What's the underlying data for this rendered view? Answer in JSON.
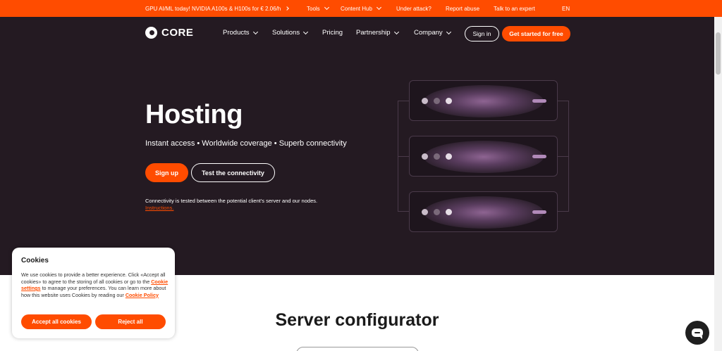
{
  "topbar": {
    "promo": "GPU AI/ML today! NVIDIA A100s & H100s for € 2.06/h",
    "tools": "Tools",
    "content_hub": "Content Hub",
    "under_attack": "Under attack?",
    "report_abuse": "Report abuse",
    "talk_expert": "Talk to an expert",
    "lang": "EN"
  },
  "header": {
    "logo": "CORE",
    "nav": {
      "products": "Products",
      "solutions": "Solutions",
      "pricing": "Pricing",
      "partnership": "Partnership",
      "company": "Company"
    },
    "sign_in": "Sign in",
    "get_started": "Get started for free"
  },
  "hero": {
    "title": "Hosting",
    "subtitle": "Instant access • Worldwide coverage • Superb connectivity",
    "sign_up": "Sign up",
    "test_connectivity": "Test the connectivity",
    "note": "Connectivity is tested between the potential client's server and our nodes.",
    "instructions": "Instructions."
  },
  "configurator": {
    "title": "Server configurator"
  },
  "cookies": {
    "title": "Cookies",
    "text_1": "We use cookies to provide a better experience. Click «Accept all cookies» to agree to the storing of all cookies or go to the",
    "settings_link": "Cookie settings",
    "text_2": "to manage your preferences. You can learn more about how this website uses Cookies by reading our",
    "policy_link": "Cookie Policy",
    "accept": "Accept all cookies",
    "reject": "Reject all"
  },
  "colors": {
    "brand": "#ff4c00",
    "hero_bg": "#241a22"
  },
  "icons": {
    "logo": "core-logo-icon",
    "chat": "chat-icon",
    "server": "server-icon"
  }
}
